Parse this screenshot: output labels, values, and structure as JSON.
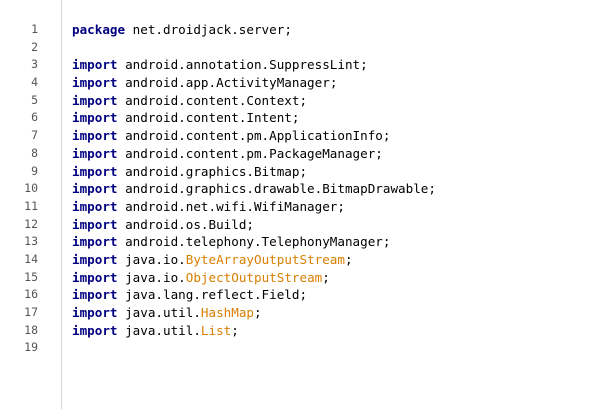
{
  "editor": {
    "language": "java",
    "colors": {
      "keyword": "#000080",
      "highlighted_class": "#d97f00",
      "line_number": "#555555",
      "text": "#000000"
    },
    "lines": [
      {
        "number": "1",
        "keyword": "package",
        "name": " net.droidjack.server",
        "cls": "",
        "end": ";"
      },
      {
        "number": "2",
        "keyword": "",
        "name": "",
        "cls": "",
        "end": ""
      },
      {
        "number": "3",
        "keyword": "import",
        "name": " android.annotation.SuppressLint",
        "cls": "",
        "end": ";"
      },
      {
        "number": "4",
        "keyword": "import",
        "name": " android.app.ActivityManager",
        "cls": "",
        "end": ";"
      },
      {
        "number": "5",
        "keyword": "import",
        "name": " android.content.Context",
        "cls": "",
        "end": ";"
      },
      {
        "number": "6",
        "keyword": "import",
        "name": " android.content.Intent",
        "cls": "",
        "end": ";"
      },
      {
        "number": "7",
        "keyword": "import",
        "name": " android.content.pm.ApplicationInfo",
        "cls": "",
        "end": ";"
      },
      {
        "number": "8",
        "keyword": "import",
        "name": " android.content.pm.PackageManager",
        "cls": "",
        "end": ";"
      },
      {
        "number": "9",
        "keyword": "import",
        "name": " android.graphics.Bitmap",
        "cls": "",
        "end": ";"
      },
      {
        "number": "10",
        "keyword": "import",
        "name": " android.graphics.drawable.BitmapDrawable",
        "cls": "",
        "end": ";"
      },
      {
        "number": "11",
        "keyword": "import",
        "name": " android.net.wifi.WifiManager",
        "cls": "",
        "end": ";"
      },
      {
        "number": "12",
        "keyword": "import",
        "name": " android.os.Build",
        "cls": "",
        "end": ";"
      },
      {
        "number": "13",
        "keyword": "import",
        "name": " android.telephony.TelephonyManager",
        "cls": "",
        "end": ";"
      },
      {
        "number": "14",
        "keyword": "import",
        "name": " java.io.",
        "cls": "ByteArrayOutputStream",
        "end": ";"
      },
      {
        "number": "15",
        "keyword": "import",
        "name": " java.io.",
        "cls": "ObjectOutputStream",
        "end": ";"
      },
      {
        "number": "16",
        "keyword": "import",
        "name": " java.lang.reflect.Field",
        "cls": "",
        "end": ";"
      },
      {
        "number": "17",
        "keyword": "import",
        "name": " java.util.",
        "cls": "HashMap",
        "end": ";"
      },
      {
        "number": "18",
        "keyword": "import",
        "name": " java.util.",
        "cls": "List",
        "end": ";"
      },
      {
        "number": "19",
        "keyword": "",
        "name": "",
        "cls": "",
        "end": ""
      }
    ]
  }
}
